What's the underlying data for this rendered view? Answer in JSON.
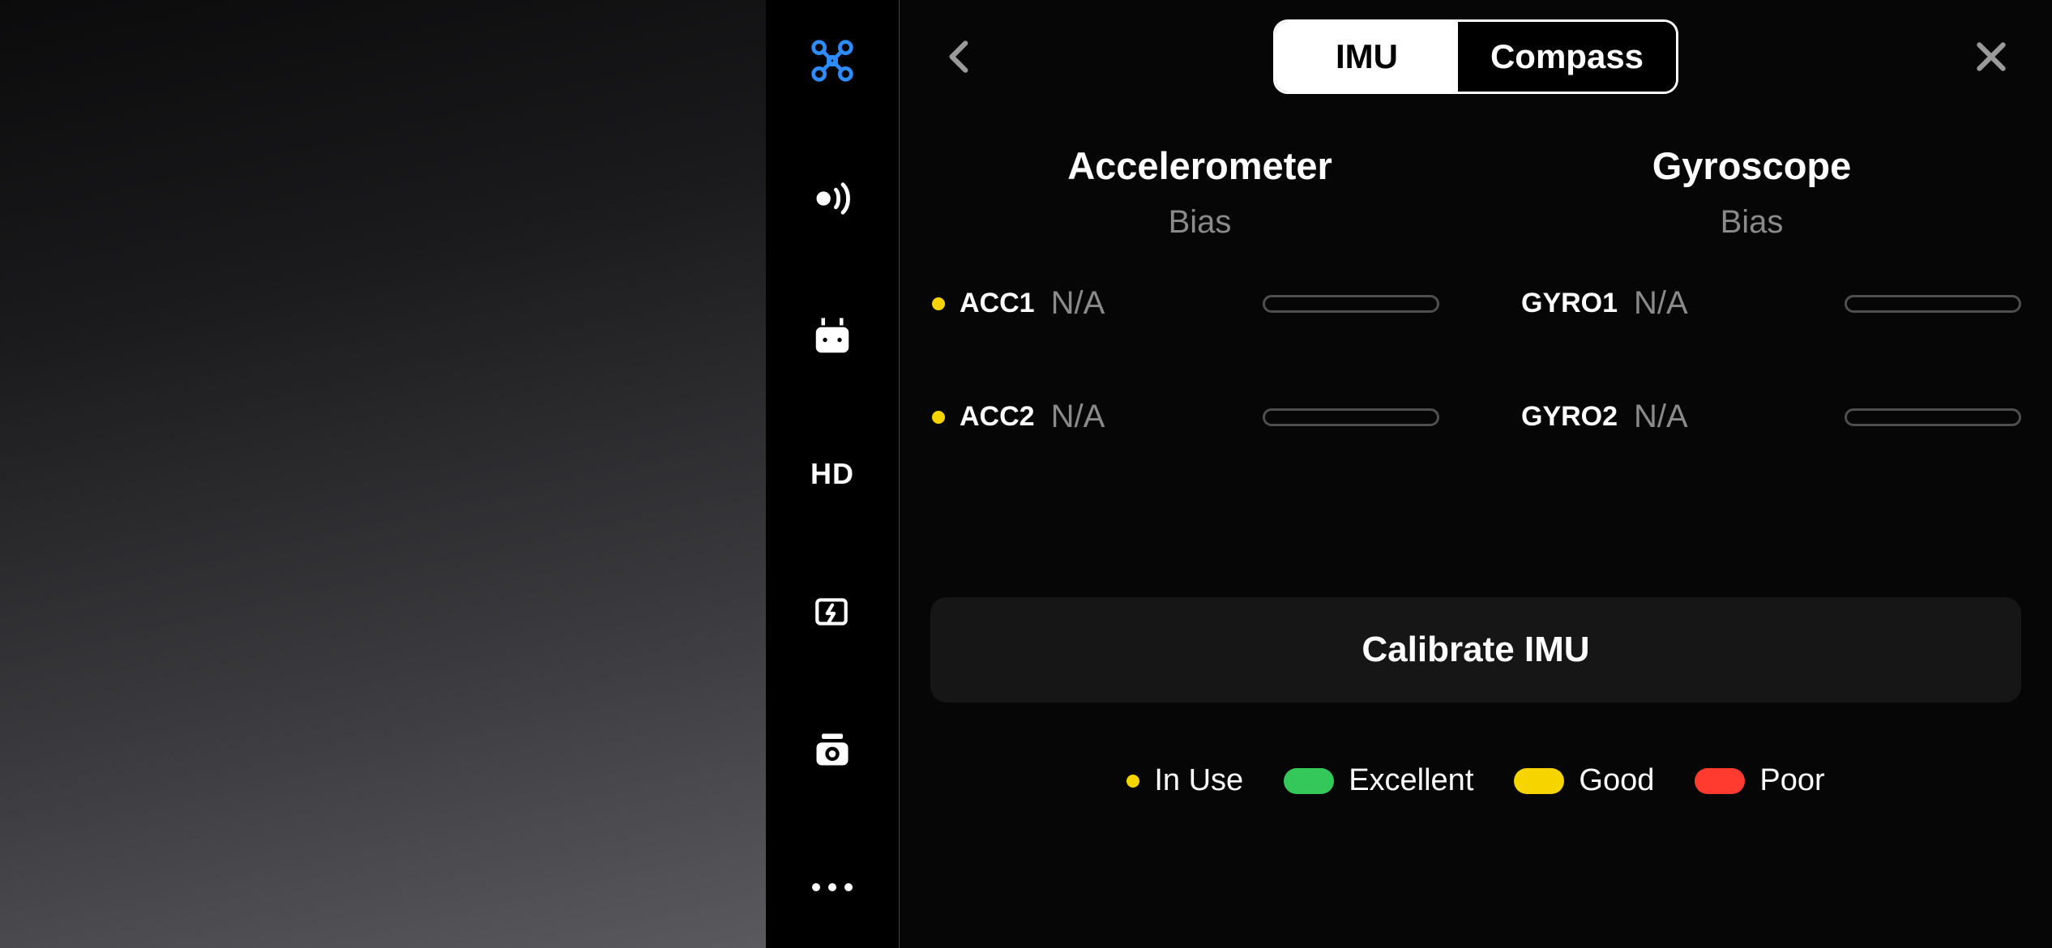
{
  "sidebar": {
    "items": [
      {
        "name": "aircraft-icon",
        "active": true
      },
      {
        "name": "sensing-icon"
      },
      {
        "name": "remote-icon"
      },
      {
        "name": "hd-icon",
        "label": "HD"
      },
      {
        "name": "battery-icon"
      },
      {
        "name": "camera-icon"
      },
      {
        "name": "more-icon"
      }
    ]
  },
  "header": {
    "tabs": {
      "imu": "IMU",
      "compass": "Compass",
      "active": "imu"
    }
  },
  "columns": {
    "accel": {
      "title": "Accelerometer",
      "sub": "Bias"
    },
    "gyro": {
      "title": "Gyroscope",
      "sub": "Bias"
    }
  },
  "sensors": [
    {
      "acc_name": "ACC1",
      "acc_val": "N/A",
      "gyro_name": "GYRO1",
      "gyro_val": "N/A",
      "in_use": true
    },
    {
      "acc_name": "ACC2",
      "acc_val": "N/A",
      "gyro_name": "GYRO2",
      "gyro_val": "N/A",
      "in_use": true
    }
  ],
  "calibrate_label": "Calibrate IMU",
  "legend": {
    "in_use": "In Use",
    "excellent": "Excellent",
    "good": "Good",
    "poor": "Poor"
  }
}
